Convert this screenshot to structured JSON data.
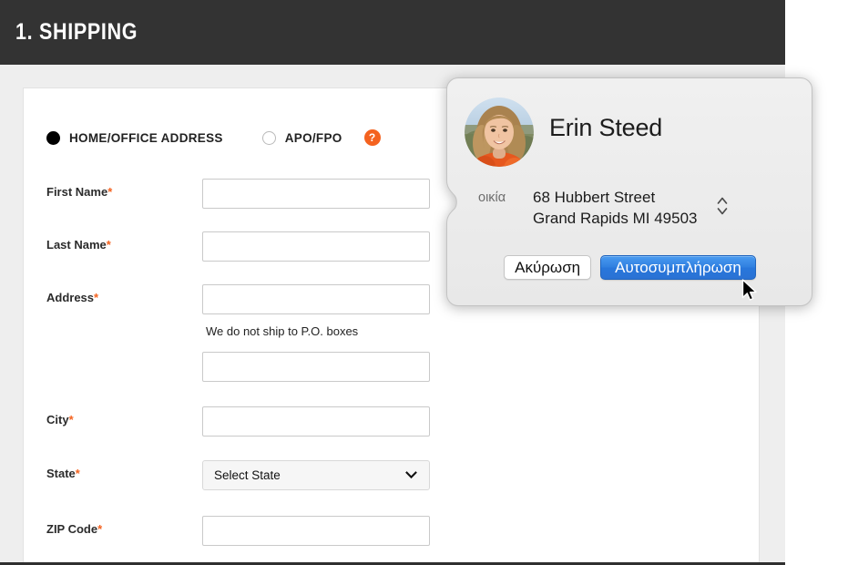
{
  "section": {
    "title": "1. SHIPPING"
  },
  "address_type": {
    "options": [
      {
        "label": "HOME/OFFICE ADDRESS",
        "selected": true
      },
      {
        "label": "APO/FPO",
        "selected": false
      }
    ],
    "help_icon": "?",
    "help_icon_name": "question-mark-icon"
  },
  "form": {
    "required_marker": "*",
    "fields": [
      {
        "label": "First Name",
        "required": true,
        "type": "text",
        "value": ""
      },
      {
        "label": "Last Name",
        "required": true,
        "type": "text",
        "value": ""
      },
      {
        "label": "Address",
        "required": true,
        "type": "text",
        "value": ""
      },
      {
        "label": "",
        "required": false,
        "type": "text",
        "value": ""
      },
      {
        "label": "City",
        "required": true,
        "type": "text",
        "value": ""
      },
      {
        "label": "State",
        "required": true,
        "type": "select",
        "value": "Select State"
      },
      {
        "label": "ZIP Code",
        "required": true,
        "type": "text",
        "value": ""
      }
    ],
    "address_hint": "We do not ship to P.O. boxes",
    "state_placeholder": "Select State"
  },
  "popover": {
    "contact_name": "Erin Steed",
    "address_label": "οικία",
    "address_line1": "68 Hubbert Street",
    "address_line2": "Grand Rapids MI 49503",
    "cancel_label": "Ακύρωση",
    "autofill_label": "Αυτοσυμπλήρωση"
  },
  "colors": {
    "header_bg": "#333333",
    "accent_orange": "#f4621f",
    "default_button_blue": "#2f7fe0",
    "page_bg": "#eeeeee",
    "card_bg": "#ffffff",
    "popover_bg": "#ececec"
  }
}
